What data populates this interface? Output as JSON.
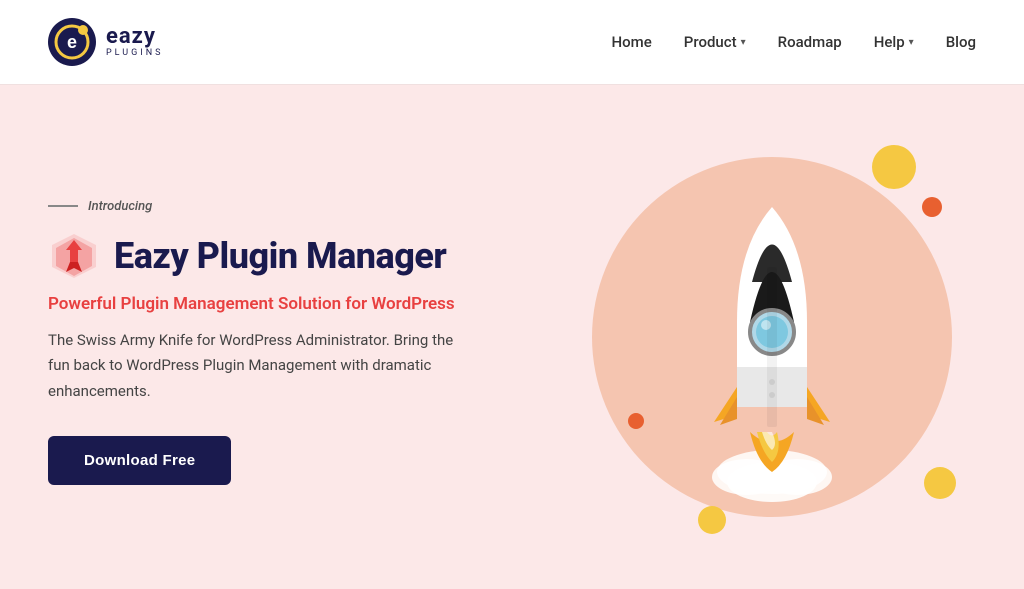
{
  "header": {
    "logo": {
      "main_text": "eazy",
      "sub_text": "PLUGINS"
    },
    "nav": {
      "items": [
        {
          "label": "Home",
          "has_dropdown": false
        },
        {
          "label": "Product",
          "has_dropdown": true
        },
        {
          "label": "Roadmap",
          "has_dropdown": false
        },
        {
          "label": "Help",
          "has_dropdown": true
        },
        {
          "label": "Blog",
          "has_dropdown": false
        }
      ]
    }
  },
  "hero": {
    "introducing_label": "Introducing",
    "product_name": "Eazy Plugin Manager",
    "tagline": "Powerful Plugin Management Solution for WordPress",
    "description": "The Swiss Army Knife for WordPress Administrator. Bring the fun back to WordPress Plugin Management with dramatic enhancements.",
    "cta_button": "Download Free"
  },
  "colors": {
    "brand_dark": "#1a1a4e",
    "brand_red": "#e84040",
    "bg_page": "#fce8e8",
    "bg_circle": "#f5c5b0",
    "yellow": "#f5c842",
    "orange": "#e86030"
  }
}
